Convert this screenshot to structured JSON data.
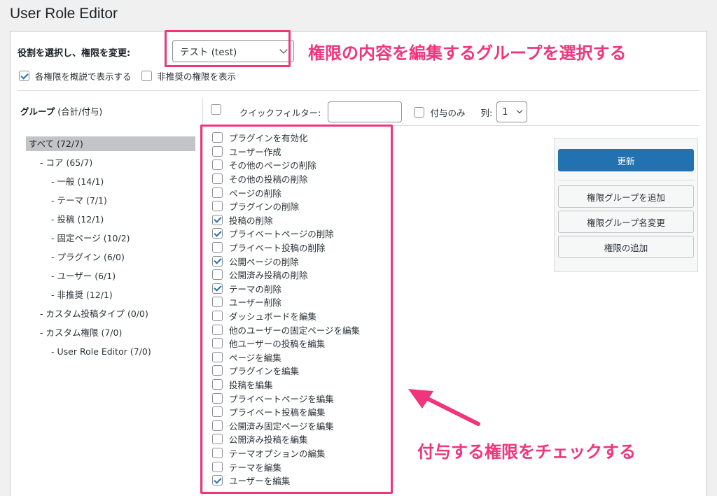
{
  "page_title": "User Role Editor",
  "role_selector": {
    "label": "役割を選択し、権限を変更:",
    "selected": "テスト (test)"
  },
  "options": [
    {
      "label": "各権限を概説で表示する",
      "checked": true
    },
    {
      "label": "非推奨の権限を表示",
      "checked": false
    }
  ],
  "groups": {
    "header_bold": "グループ",
    "header_suffix": " (合計/付与)",
    "items": [
      {
        "label": "すべて (72/7)",
        "indent": 0,
        "selected": true
      },
      {
        "label": "- コア (65/7)",
        "indent": 1
      },
      {
        "label": "- 一般 (14/1)",
        "indent": 2
      },
      {
        "label": "- テーマ (7/1)",
        "indent": 2
      },
      {
        "label": "- 投稿 (12/1)",
        "indent": 2
      },
      {
        "label": "- 固定ページ (10/2)",
        "indent": 2
      },
      {
        "label": "- プラグイン (6/0)",
        "indent": 2
      },
      {
        "label": "- ユーザー (6/1)",
        "indent": 2
      },
      {
        "label": "- 非推奨 (12/1)",
        "indent": 2
      },
      {
        "label": "- カスタム投稿タイプ (0/0)",
        "indent": 1
      },
      {
        "label": "- カスタム権限 (7/0)",
        "indent": 1
      },
      {
        "label": "- User Role Editor (7/0)",
        "indent": 2
      }
    ]
  },
  "filter": {
    "quick_filter_label": "クイックフィルター:",
    "quick_filter_value": "",
    "granted_only_label": "付与のみ",
    "columns_label": "列:",
    "columns_value": "1"
  },
  "capabilities": [
    {
      "label": "プラグインを有効化",
      "checked": false
    },
    {
      "label": "ユーザー作成",
      "checked": false
    },
    {
      "label": "その他のページの削除",
      "checked": false
    },
    {
      "label": "その他の投稿の削除",
      "checked": false
    },
    {
      "label": "ページの削除",
      "checked": false
    },
    {
      "label": "プラグインの削除",
      "checked": false
    },
    {
      "label": "投稿の削除",
      "checked": true
    },
    {
      "label": "プライベートページの削除",
      "checked": true
    },
    {
      "label": "プライベート投稿の削除",
      "checked": false
    },
    {
      "label": "公開ページの削除",
      "checked": true
    },
    {
      "label": "公開済み投稿の削除",
      "checked": false
    },
    {
      "label": "テーマの削除",
      "checked": true
    },
    {
      "label": "ユーザー削除",
      "checked": false
    },
    {
      "label": "ダッシュボードを編集",
      "checked": false
    },
    {
      "label": "他のユーザーの固定ページを編集",
      "checked": false
    },
    {
      "label": "他ユーザーの投稿を編集",
      "checked": false
    },
    {
      "label": "ページを編集",
      "checked": false
    },
    {
      "label": "プラグインを編集",
      "checked": false
    },
    {
      "label": "投稿を編集",
      "checked": false
    },
    {
      "label": "プライベートページを編集",
      "checked": false
    },
    {
      "label": "プライベート投稿を編集",
      "checked": false
    },
    {
      "label": "公開済み固定ページを編集",
      "checked": false
    },
    {
      "label": "公開済み投稿を編集",
      "checked": false
    },
    {
      "label": "テーマオプションの編集",
      "checked": false
    },
    {
      "label": "テーマを編集",
      "checked": false
    },
    {
      "label": "ユーザーを編集",
      "checked": true
    }
  ],
  "actions": {
    "update": "更新",
    "add_group": "権限グループを追加",
    "rename_group": "権限グループ名変更",
    "add_capability": "権限の追加"
  },
  "annotations": {
    "select_group": "権限の内容を編集するグループを選択する",
    "check_caps": "付与する権限をチェックする",
    "color": "#f0357d"
  }
}
